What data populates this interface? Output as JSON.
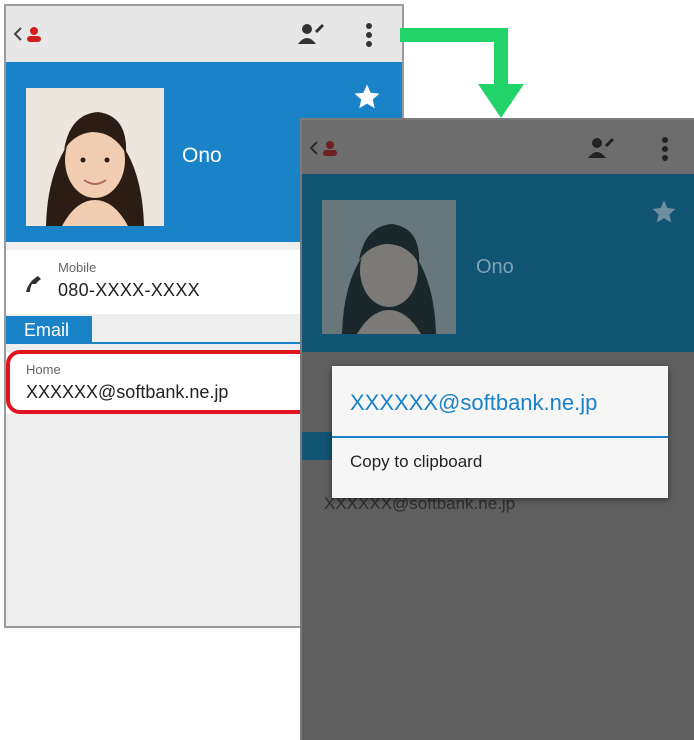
{
  "left_screen": {
    "contact": {
      "name": "Ono"
    },
    "phone": {
      "type": "Mobile",
      "number": "080-XXXX-XXXX"
    },
    "section": {
      "label": "Email"
    },
    "email": {
      "type": "Home",
      "address": "XXXXXX@softbank.ne.jp"
    }
  },
  "right_screen": {
    "contact": {
      "name": "Ono"
    },
    "email_dimmed": "XXXXXX@softbank.ne.jp",
    "dialog": {
      "title": "XXXXXX@softbank.ne.jp",
      "items": [
        "Copy to clipboard"
      ]
    }
  },
  "icons": {
    "back": "chevron-left-icon",
    "contact_app": "contact-icon",
    "edit": "edit-contact-icon",
    "menu": "overflow-menu-icon",
    "favorite": "star-icon",
    "phone": "phone-icon",
    "transition_arrow": "arrow-down-icon"
  },
  "colors": {
    "accent": "#1a82c7",
    "highlight": "#e0141e",
    "arrow": "#22d36a"
  }
}
